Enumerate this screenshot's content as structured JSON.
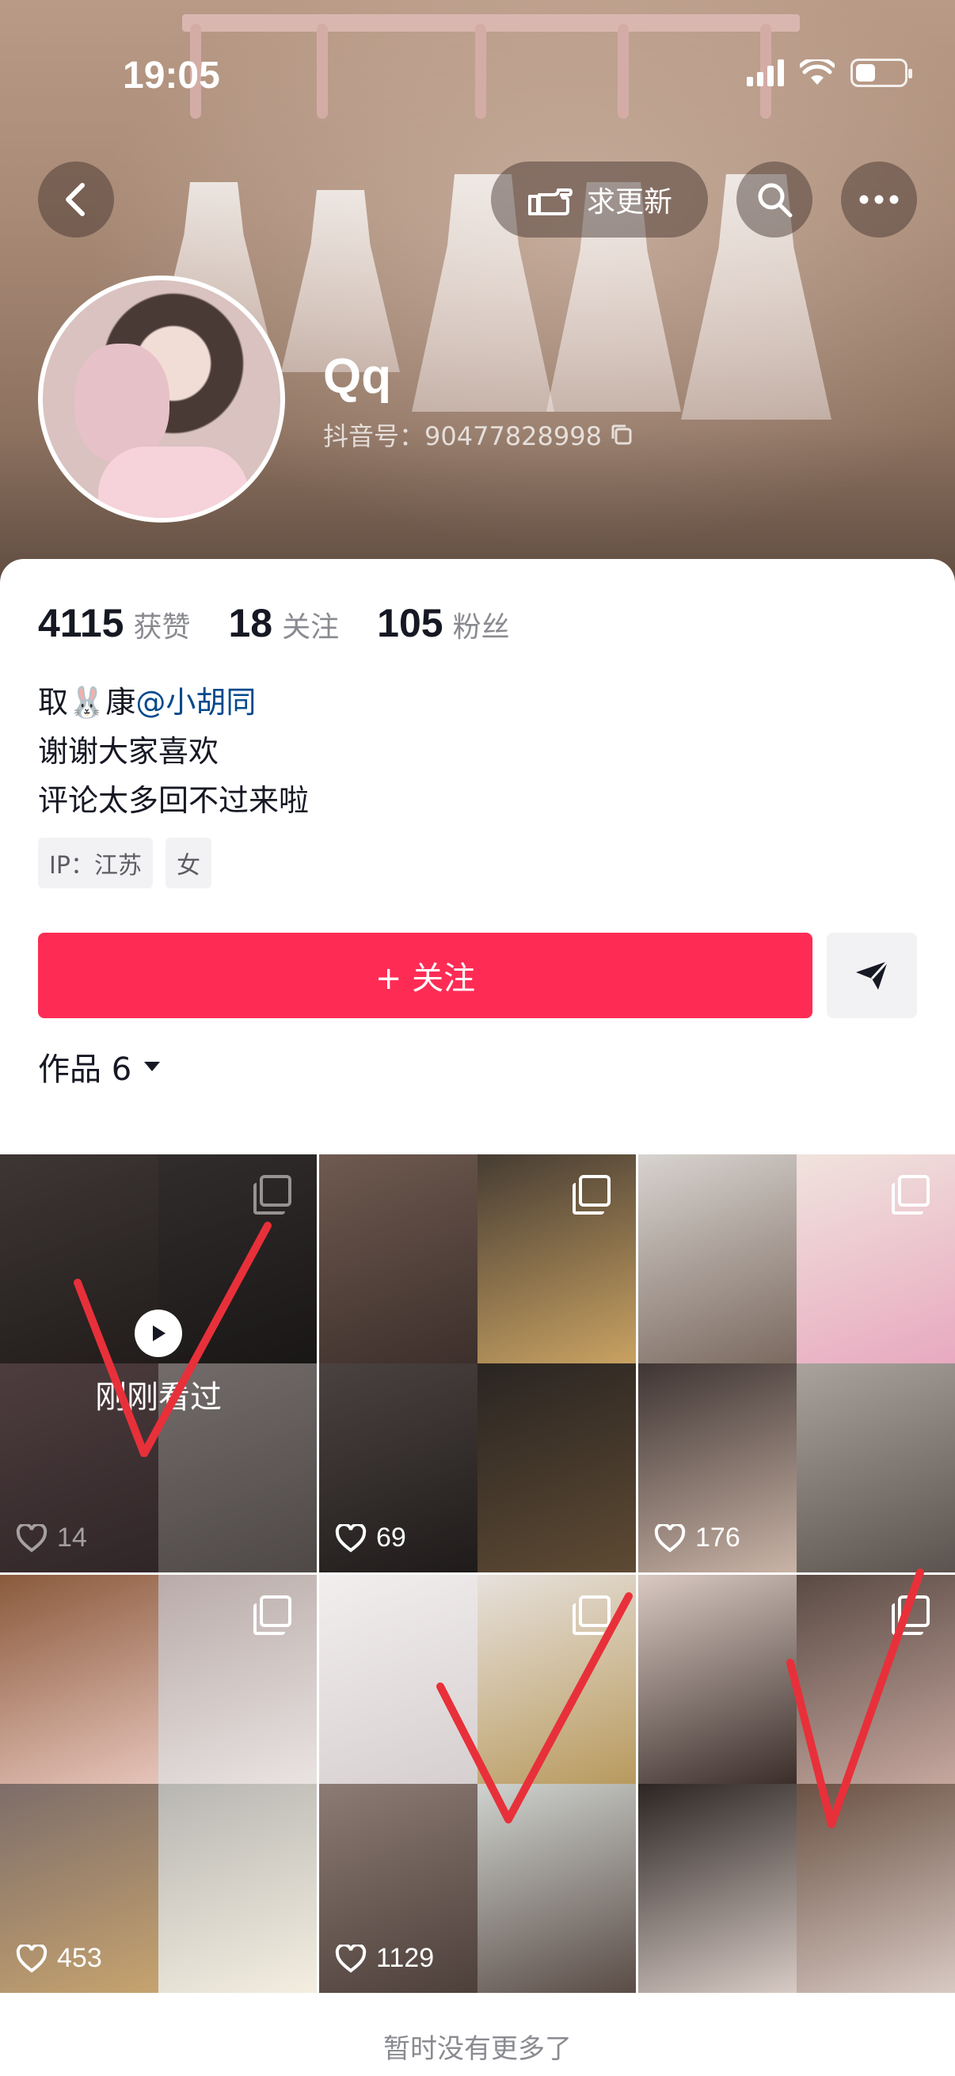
{
  "status_bar": {
    "time": "19:05"
  },
  "header": {
    "request_update_label": "求更新",
    "nickname": "Qq",
    "douyin_id": "抖音号：90477828998"
  },
  "stats": [
    {
      "value": "4115",
      "label": "获赞"
    },
    {
      "value": "18",
      "label": "关注"
    },
    {
      "value": "105",
      "label": "粉丝"
    }
  ],
  "bio": {
    "line1_prefix": "取🐰康",
    "line1_mention": "@小胡同",
    "line2": "谢谢大家喜欢",
    "line3": "评论太多回不过来啦"
  },
  "tags": [
    "IP：江苏",
    "女"
  ],
  "actions": {
    "follow_label": "+ 关注"
  },
  "works": {
    "title": "作品 6",
    "watched_label": "刚刚看过",
    "items": [
      {
        "likes": "14"
      },
      {
        "likes": "69"
      },
      {
        "likes": "176"
      },
      {
        "likes": "453"
      },
      {
        "likes": "1129"
      },
      {
        "likes": ""
      }
    ]
  },
  "footer": {
    "text": "暂时没有更多了"
  },
  "colors": {
    "accent": "#fe2c55",
    "mention": "#04498d",
    "check_marks": "#e8303a"
  }
}
